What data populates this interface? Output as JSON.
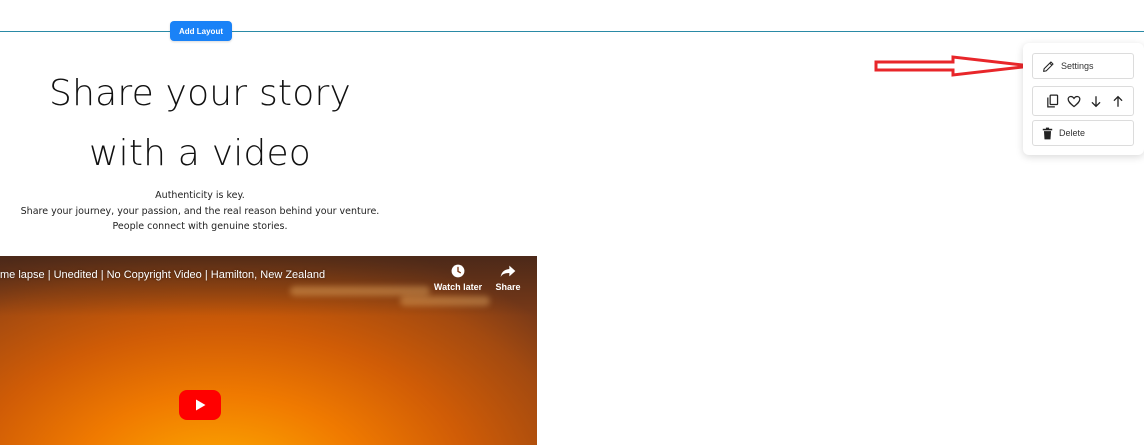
{
  "toolbar": {
    "add_layout_label": "Add Layout"
  },
  "hero": {
    "headline_line1": "Share your story",
    "headline_line2": "with a video",
    "body_lines": [
      "Authenticity is key.",
      "Share your journey, your passion, and the real reason behind your venture.",
      "People connect with genuine stories."
    ]
  },
  "video": {
    "title": "me lapse | Unedited | No Copyright Video | Hamilton, New Zealand",
    "watch_later_label": "Watch later",
    "share_label": "Share",
    "play_color": "#ff0000"
  },
  "context_menu": {
    "settings_label": "Settings",
    "delete_label": "Delete",
    "icons": [
      "copy-icon",
      "heart-icon",
      "arrow-down-icon",
      "arrow-up-icon"
    ]
  },
  "annotation": {
    "arrow_color": "#e8262a",
    "arrow_icon": "red-arrow"
  },
  "colors": {
    "accent": "#1a82f7",
    "divider": "#2a8aa6"
  }
}
